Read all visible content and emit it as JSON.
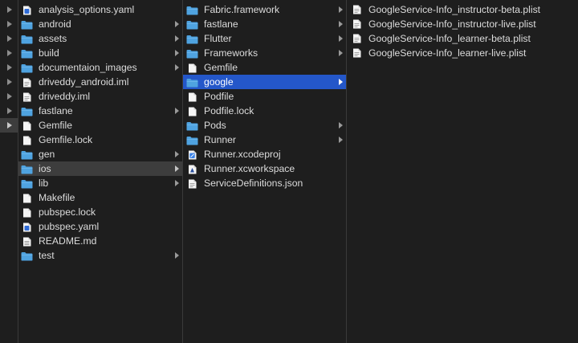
{
  "colors": {
    "background": "#1e1e1e",
    "selection": "#2457c9",
    "inactive_selection": "#3d3d3d",
    "folder": "#4fa3e0",
    "text": "#dcdcdc"
  },
  "root_column": {
    "rows": [
      {
        "active": false
      },
      {
        "active": false
      },
      {
        "active": false
      },
      {
        "active": false
      },
      {
        "active": false
      },
      {
        "active": false
      },
      {
        "active": false
      },
      {
        "active": false
      },
      {
        "active": true
      }
    ]
  },
  "column_1": {
    "items": [
      {
        "name": "analysis_options.yaml",
        "icon": "yaml-file-icon",
        "folder": false
      },
      {
        "name": "android",
        "icon": "folder-icon",
        "folder": true
      },
      {
        "name": "assets",
        "icon": "folder-icon",
        "folder": true
      },
      {
        "name": "build",
        "icon": "folder-icon",
        "folder": true
      },
      {
        "name": "documentaion_images",
        "icon": "folder-icon",
        "folder": true
      },
      {
        "name": "driveddy_android.iml",
        "icon": "iml-file-icon",
        "folder": false
      },
      {
        "name": "driveddy.iml",
        "icon": "iml-file-icon",
        "folder": false
      },
      {
        "name": "fastlane",
        "icon": "folder-icon",
        "folder": true
      },
      {
        "name": "Gemfile",
        "icon": "document-icon",
        "folder": false
      },
      {
        "name": "Gemfile.lock",
        "icon": "document-icon",
        "folder": false
      },
      {
        "name": "gen",
        "icon": "folder-icon",
        "folder": true
      },
      {
        "name": "ios",
        "icon": "folder-icon",
        "folder": true,
        "active": true
      },
      {
        "name": "lib",
        "icon": "folder-icon",
        "folder": true
      },
      {
        "name": "Makefile",
        "icon": "document-icon",
        "folder": false
      },
      {
        "name": "pubspec.lock",
        "icon": "document-icon",
        "folder": false
      },
      {
        "name": "pubspec.yaml",
        "icon": "yaml-file-icon",
        "folder": false
      },
      {
        "name": "README.md",
        "icon": "markdown-file-icon",
        "folder": false
      },
      {
        "name": "test",
        "icon": "folder-icon",
        "folder": true
      }
    ]
  },
  "column_2": {
    "items": [
      {
        "name": "Fabric.framework",
        "icon": "folder-icon",
        "folder": true
      },
      {
        "name": "fastlane",
        "icon": "folder-icon",
        "folder": true
      },
      {
        "name": "Flutter",
        "icon": "folder-icon",
        "folder": true
      },
      {
        "name": "Frameworks",
        "icon": "folder-icon",
        "folder": true
      },
      {
        "name": "Gemfile",
        "icon": "document-icon",
        "folder": false
      },
      {
        "name": "google",
        "icon": "folder-icon",
        "folder": true,
        "selected": true
      },
      {
        "name": "Podfile",
        "icon": "document-icon",
        "folder": false
      },
      {
        "name": "Podfile.lock",
        "icon": "document-icon",
        "folder": false
      },
      {
        "name": "Pods",
        "icon": "folder-icon",
        "folder": true
      },
      {
        "name": "Runner",
        "icon": "folder-icon",
        "folder": true
      },
      {
        "name": "Runner.xcodeproj",
        "icon": "xcodeproj-icon",
        "folder": false
      },
      {
        "name": "Runner.xcworkspace",
        "icon": "xcworkspace-icon",
        "folder": false
      },
      {
        "name": "ServiceDefinitions.json",
        "icon": "json-file-icon",
        "folder": false
      }
    ]
  },
  "column_3": {
    "items": [
      {
        "name": "GoogleService-Info_instructor-beta.plist",
        "icon": "plist-file-icon",
        "folder": false
      },
      {
        "name": "GoogleService-Info_instructor-live.plist",
        "icon": "plist-file-icon",
        "folder": false
      },
      {
        "name": "GoogleService-Info_learner-beta.plist",
        "icon": "plist-file-icon",
        "folder": false
      },
      {
        "name": "GoogleService-Info_learner-live.plist",
        "icon": "plist-file-icon",
        "folder": false
      }
    ]
  }
}
